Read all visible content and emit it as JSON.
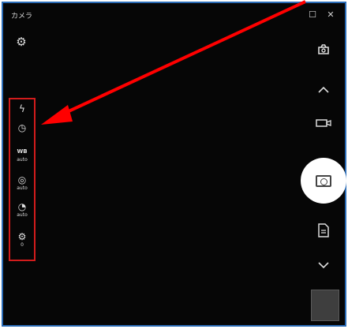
{
  "window": {
    "title": "カメラ",
    "maximize_glyph": "☐",
    "close_glyph": "✕"
  },
  "left_panel": {
    "items": [
      {
        "icon": "flash-icon",
        "glyph": "ϟ",
        "label": ""
      },
      {
        "icon": "timer-icon",
        "glyph": "◷",
        "label": ""
      },
      {
        "icon": "white-balance-icon",
        "glyph": "WB",
        "label": "auto"
      },
      {
        "icon": "focus-icon",
        "glyph": "◎",
        "label": "auto"
      },
      {
        "icon": "exposure-icon",
        "glyph": "◔",
        "label": "auto"
      },
      {
        "icon": "brightness-icon",
        "glyph": "⚙",
        "label": "0"
      }
    ]
  },
  "right_controls": {
    "switch_camera_icon": "switch-camera-icon",
    "collapse_icon": "chevron-up-icon",
    "video_icon": "video-icon",
    "photo_icon": "camera-icon",
    "document_icon": "document-icon",
    "expand_icon": "chevron-down-icon"
  },
  "colors": {
    "background": "#060606",
    "frame_border": "#2a6bb6",
    "highlight_border": "#d21c1c",
    "annotation_arrow": "#ff0000",
    "shutter": "#ffffff"
  }
}
